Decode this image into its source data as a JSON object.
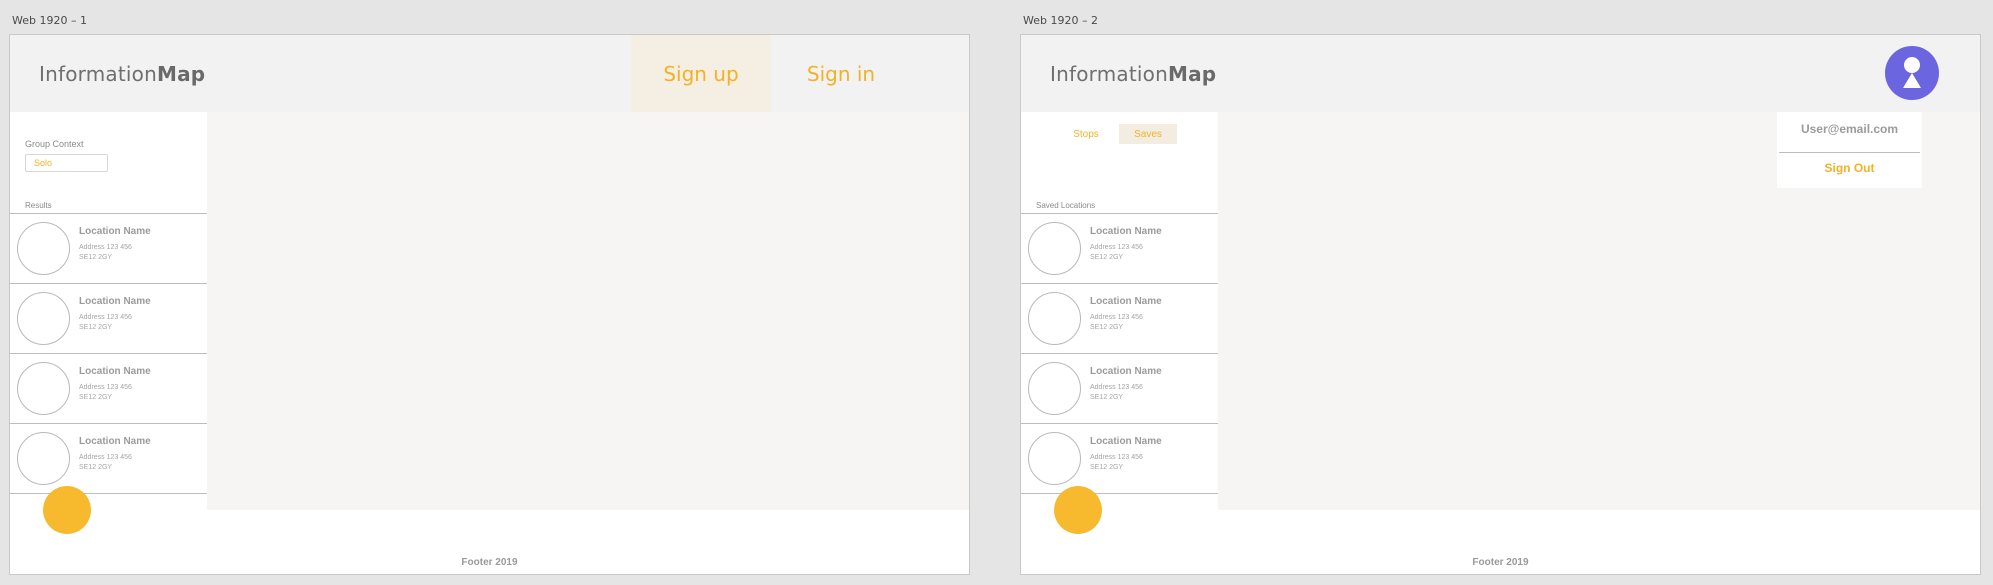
{
  "artboards": [
    {
      "label": "Web 1920 – 1"
    },
    {
      "label": "Web 1920 – 2"
    }
  ],
  "brand": {
    "light": "Information",
    "bold": "Map"
  },
  "screen1": {
    "nav": {
      "signup": "Sign up",
      "signin": "Sign in"
    },
    "group_context": {
      "label": "Group Context",
      "value": "Solo"
    },
    "results_label": "Results"
  },
  "screen2": {
    "tabs": {
      "stops": "Stops",
      "saves": "Saves"
    },
    "saved_label": "Saved Locations",
    "user_menu": {
      "email": "User@email.com",
      "signout": "Sign Out"
    }
  },
  "locations": [
    {
      "name": "Location Name",
      "address": "Address 123 456",
      "postcode": "SE12 2GY"
    },
    {
      "name": "Location Name",
      "address": "Address 123 456",
      "postcode": "SE12 2GY"
    },
    {
      "name": "Location Name",
      "address": "Address 123 456",
      "postcode": "SE12 2GY"
    },
    {
      "name": "Location Name",
      "address": "Address 123 456",
      "postcode": "SE12 2GY"
    }
  ],
  "footer": "Footer 2019",
  "icons": {
    "avatar": "user-icon",
    "fab": "action-button"
  },
  "colors": {
    "accent": "#f3b226",
    "fab": "#f7ba2f",
    "avatar": "#6b66e0",
    "map_bg": "#f6f5f4",
    "header_bg": "#f2f2f2"
  }
}
